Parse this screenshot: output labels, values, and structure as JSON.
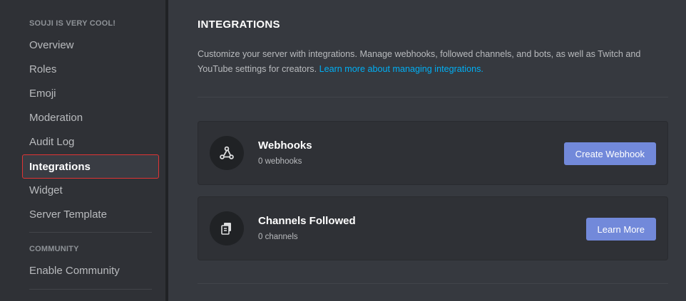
{
  "sidebar": {
    "server_header": "SOUJI IS VERY COOL!",
    "items": [
      {
        "label": "Overview"
      },
      {
        "label": "Roles"
      },
      {
        "label": "Emoji"
      },
      {
        "label": "Moderation"
      },
      {
        "label": "Audit Log"
      },
      {
        "label": "Integrations",
        "active": true
      },
      {
        "label": "Widget"
      },
      {
        "label": "Server Template"
      }
    ],
    "community_header": "COMMUNITY",
    "community_items": [
      {
        "label": "Enable Community"
      }
    ]
  },
  "main": {
    "title": "INTEGRATIONS",
    "description": "Customize your server with integrations. Manage webhooks, followed channels, and bots, as well as Twitch and YouTube settings for creators.",
    "learn_more_link": "Learn more about managing integrations.",
    "cards": [
      {
        "title": "Webhooks",
        "subtitle": "0 webhooks",
        "button": "Create Webhook",
        "icon": "webhook-icon"
      },
      {
        "title": "Channels Followed",
        "subtitle": "0 channels",
        "button": "Learn More",
        "icon": "channels-followed-icon"
      }
    ]
  },
  "colors": {
    "sidebar_bg": "#2f3136",
    "main_bg": "#36393f",
    "accent": "#7289da",
    "link": "#00aff4",
    "active_outline": "#e03434"
  }
}
